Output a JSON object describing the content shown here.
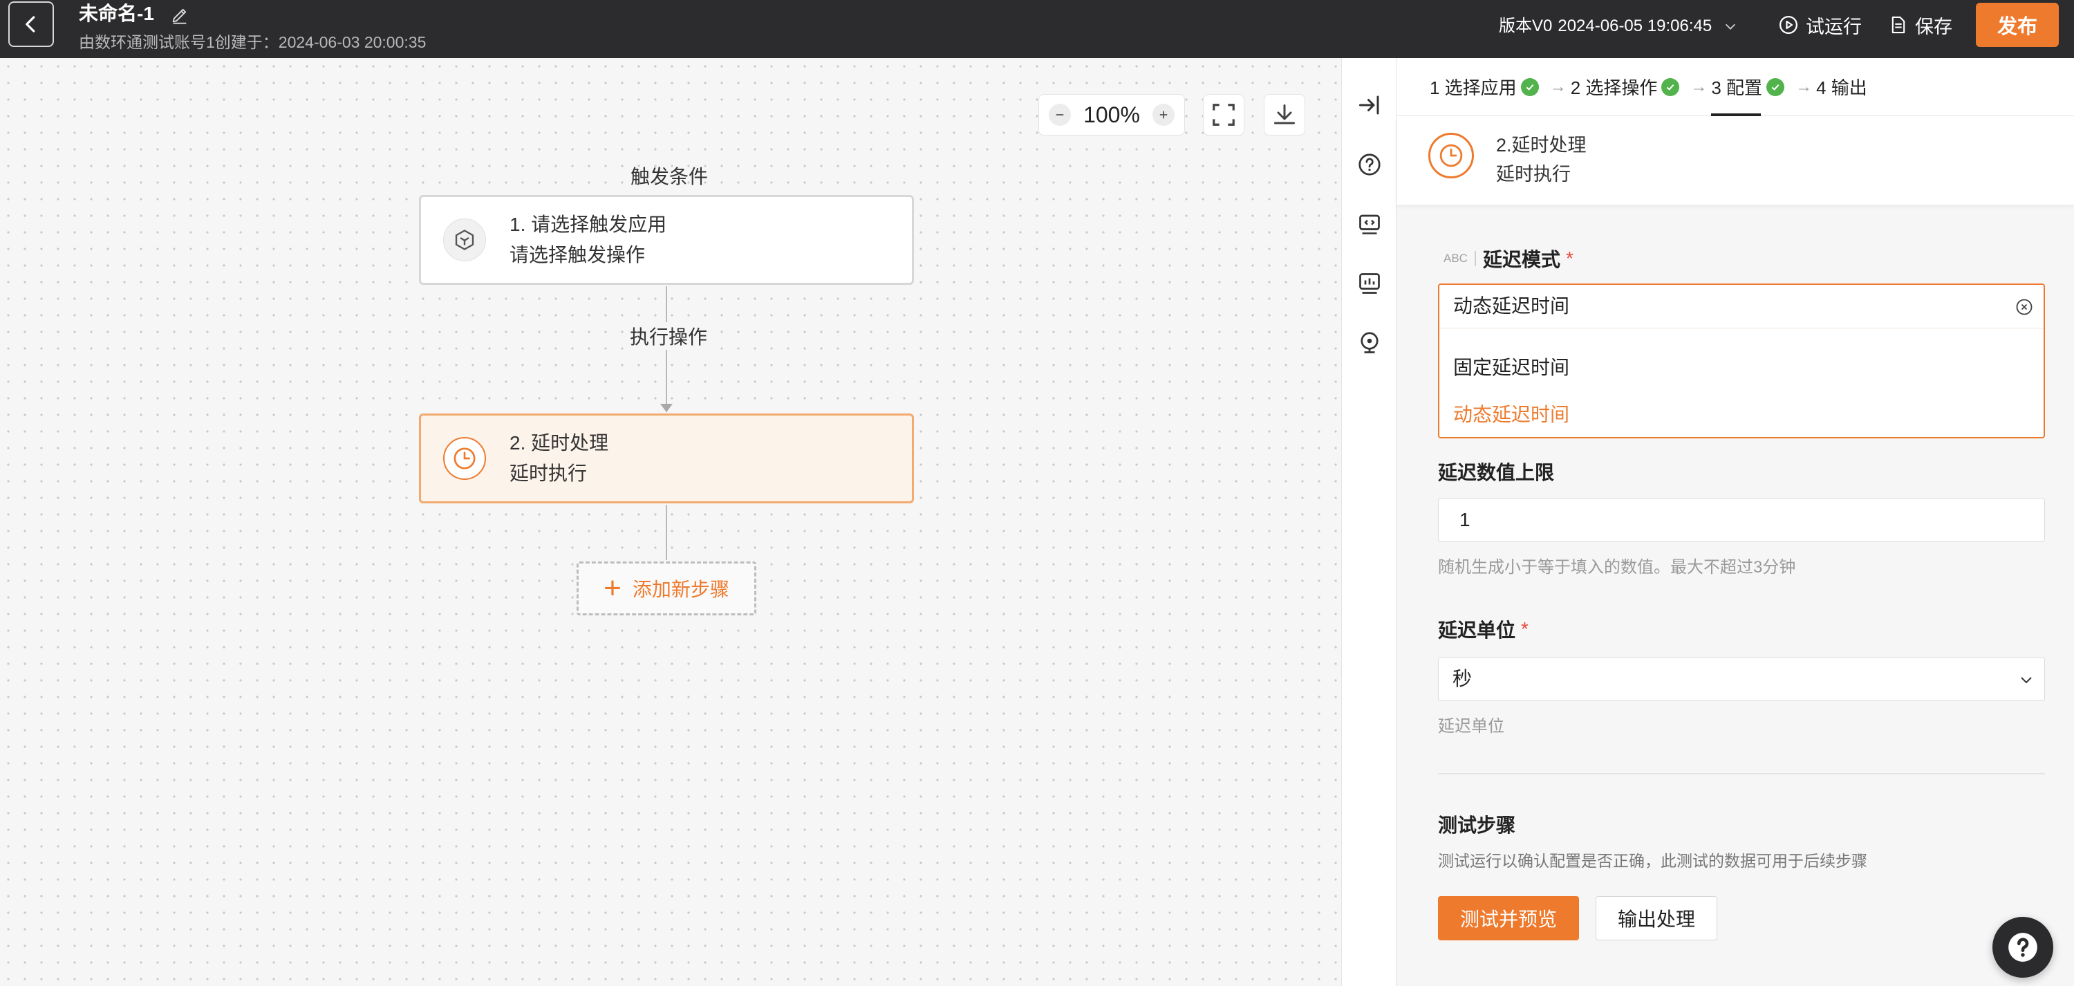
{
  "header": {
    "title": "未命名-1",
    "creator": "由数环通测试账号1创建于：",
    "created_at": "2024-06-03 20:00:35",
    "version_label": "版本V0",
    "version_time": "2024-06-05 19:06:45",
    "trial_run_label": "试运行",
    "save_label": "保存",
    "publish_label": "发布",
    "bg_color": "#2c2c2e",
    "accent_color": "#ee7a2d"
  },
  "canvas": {
    "zoom_level": "100%",
    "trigger_caption": "触发条件",
    "exec_caption": "执行操作",
    "nodes": [
      {
        "title": "1. 请选择触发应用",
        "subtitle": "请选择触发操作",
        "icon": "cube-icon"
      },
      {
        "title": "2. 延时处理",
        "subtitle": "延时执行",
        "icon": "clock-icon"
      }
    ],
    "add_step_label": "添加新步骤"
  },
  "side_strip": {
    "icons": [
      "collapse-panel-icon",
      "help-icon",
      "code-icon",
      "logs-icon",
      "location-icon"
    ]
  },
  "panel": {
    "steps": [
      {
        "label": "1 选择应用",
        "done": true
      },
      {
        "label": "2 选择操作",
        "done": true
      },
      {
        "label": "3 配置",
        "done": true,
        "active": true
      },
      {
        "label": "4 输出",
        "done": false
      }
    ],
    "header": {
      "title": "2.延时处理",
      "subtitle": "延时执行"
    },
    "mode_field": {
      "type_tag": "ABC",
      "label": "延迟模式",
      "value": "动态延迟时间",
      "options": [
        "固定延迟时间",
        "动态延迟时间"
      ],
      "selected_index": 1
    },
    "max_field": {
      "label": "延迟数值上限",
      "value": "1",
      "help": "随机生成小于等于填入的数值。最大不超过3分钟"
    },
    "unit_field": {
      "label": "延迟单位",
      "value": "秒",
      "help": "延迟单位"
    },
    "test": {
      "title": "测试步骤",
      "description": "测试运行以确认配置是否正确，此测试的数据可用于后续步骤",
      "primary_label": "测试并预览",
      "secondary_label": "输出处理"
    },
    "required_mark": "*"
  }
}
